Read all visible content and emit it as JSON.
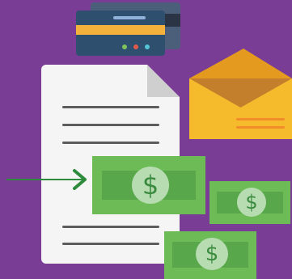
{
  "colors": {
    "background": "#7a3d96",
    "card_front": "#2f4f6e",
    "card_back": "#4b5f7b",
    "card_band": "#f4b13b",
    "document": "#f5f5f5",
    "document_lines": "#5c5c5c",
    "envelope": "#f6bb2c",
    "envelope_flap": "#c37f2c",
    "bill": "#6dbb57",
    "bill_inner": "#58a84b",
    "arrow": "#2e8b3c"
  },
  "icons": {
    "card_front": "credit-card-icon",
    "card_back": "credit-card-icon",
    "document": "document-icon",
    "envelope": "envelope-icon",
    "arrow": "arrow-right-icon",
    "bills": "dollar-bill-icon"
  },
  "bills": {
    "main_symbol": "$",
    "right_symbol": "$",
    "bottom_symbol": "$"
  }
}
